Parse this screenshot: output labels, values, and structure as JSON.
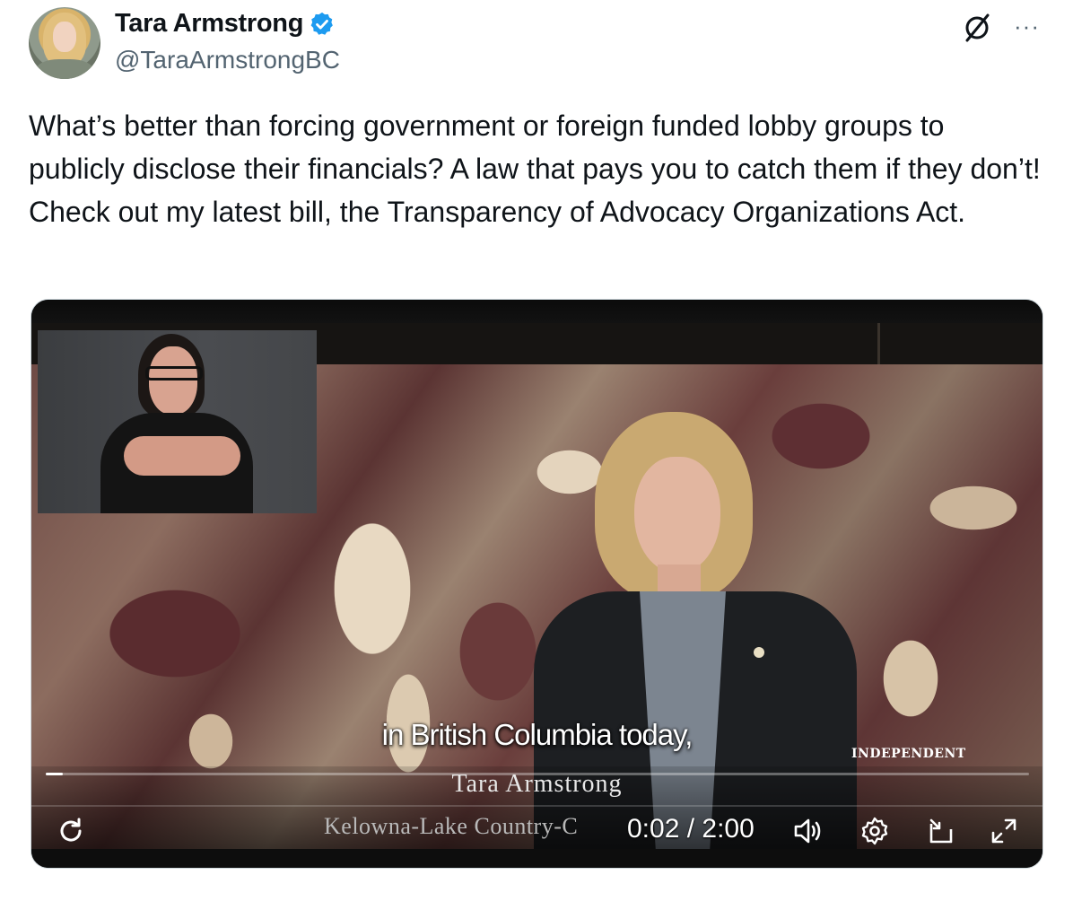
{
  "author": {
    "display_name": "Tara Armstrong",
    "handle": "@TaraArmstrongBC",
    "verified": true
  },
  "tweet": {
    "text": "What’s better than forcing government or foreign funded lobby groups to publicly disclose their financials? A law that pays you to catch them if they don’t! Check out my latest bill, the Transparency of Advocacy Organizations Act."
  },
  "header_icons": {
    "grok": "grok-slash-icon",
    "more": "···"
  },
  "video": {
    "caption": "in British Columbia today,",
    "party_tag": "INDEPENDENT",
    "speaker_name": "Tara Armstrong",
    "riding": "Kelowna-Lake Country-C",
    "current_time": "0:02",
    "duration": "2:00",
    "time_display": "0:02 / 2:00",
    "progress": 0.017,
    "icons": {
      "replay": "replay-icon",
      "volume": "volume-icon",
      "settings": "settings-gear-icon",
      "pip": "picture-in-picture-icon",
      "fullscreen": "fullscreen-icon"
    }
  },
  "colors": {
    "verified_blue": "#1d9bf0",
    "text_primary": "#0f1419",
    "text_secondary": "#536471",
    "border": "#cfd9de"
  }
}
